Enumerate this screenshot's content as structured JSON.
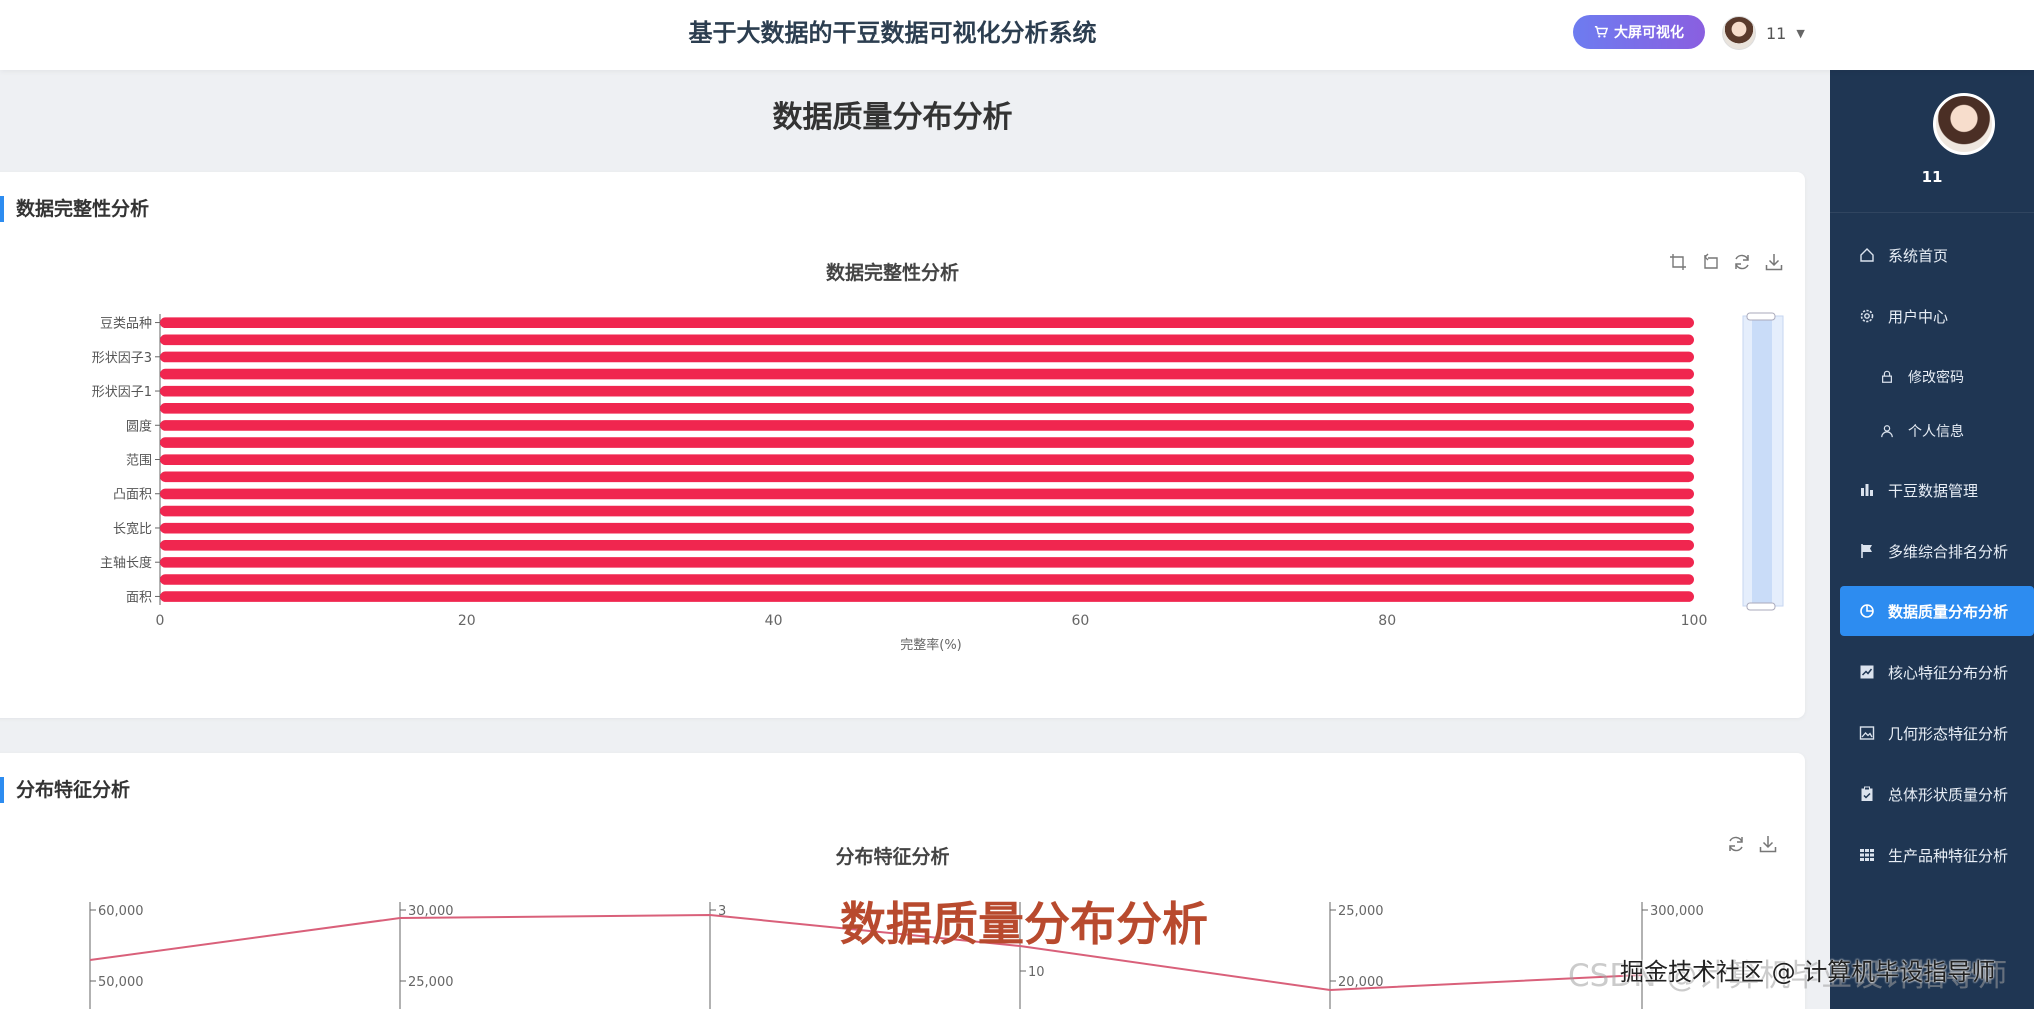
{
  "header": {
    "system_title": "基于大数据的干豆数据可视化分析系统",
    "screen_button_label": "大屏可视化",
    "user_name": "11"
  },
  "sidebar": {
    "user_name": "11",
    "items": [
      {
        "label": "系统首页",
        "icon": "home-icon"
      },
      {
        "label": "用户中心",
        "icon": "gear-icon"
      },
      {
        "label": "修改密码",
        "icon": "lock-icon"
      },
      {
        "label": "个人信息",
        "icon": "user-icon"
      },
      {
        "label": "干豆数据管理",
        "icon": "bar-chart-icon"
      },
      {
        "label": "多维综合排名分析",
        "icon": "flag-icon"
      },
      {
        "label": "数据质量分布分析",
        "icon": "pie-chart-icon"
      },
      {
        "label": "核心特征分布分析",
        "icon": "trend-icon"
      },
      {
        "label": "几何形态特征分析",
        "icon": "image-icon"
      },
      {
        "label": "总体形状质量分析",
        "icon": "clipboard-icon"
      },
      {
        "label": "生产品种特征分析",
        "icon": "grid-icon"
      }
    ],
    "active_index": 6
  },
  "page": {
    "title": "数据质量分布分析"
  },
  "cards": {
    "completeness": {
      "section_title": "数据完整性分析",
      "chart_title": "数据完整性分析"
    },
    "distribution": {
      "section_title": "分布特征分析",
      "chart_title": "分布特征分析"
    }
  },
  "chart_data": [
    {
      "type": "bar",
      "orientation": "horizontal",
      "title": "数据完整性分析",
      "xlabel": "完整率(%)",
      "xlim": [
        0,
        100
      ],
      "x_ticks": [
        0,
        20,
        40,
        60,
        80,
        100
      ],
      "visible_category_labels": [
        "豆类品种",
        "形状因子3",
        "形状因子1",
        "圆度",
        "范围",
        "凸面积",
        "长宽比",
        "主轴长度",
        "面积"
      ],
      "bar_count": 17,
      "values": [
        100,
        100,
        100,
        100,
        100,
        100,
        100,
        100,
        100,
        100,
        100,
        100,
        100,
        100,
        100,
        100,
        100
      ],
      "color": "#f0264f",
      "has_datazoom": true
    },
    {
      "type": "line",
      "subtype": "parallel-coordinates",
      "title": "分布特征分析",
      "axes": [
        {
          "ticks": [
            "60,000",
            "50,000"
          ]
        },
        {
          "ticks": [
            "30,000",
            "25,000"
          ]
        },
        {
          "ticks": [
            "3"
          ]
        },
        {
          "ticks": [
            "10"
          ]
        },
        {
          "ticks": [
            "25,000",
            "20,000"
          ]
        },
        {
          "ticks": [
            "300,000"
          ]
        }
      ],
      "color": "#d9607a"
    }
  ],
  "overlay": {
    "caption": "数据质量分布分析",
    "watermark_back": "CSDN @计算机毕业设计指导师",
    "watermark_front": "掘金技术社区 @ 计算机毕设指导师"
  }
}
